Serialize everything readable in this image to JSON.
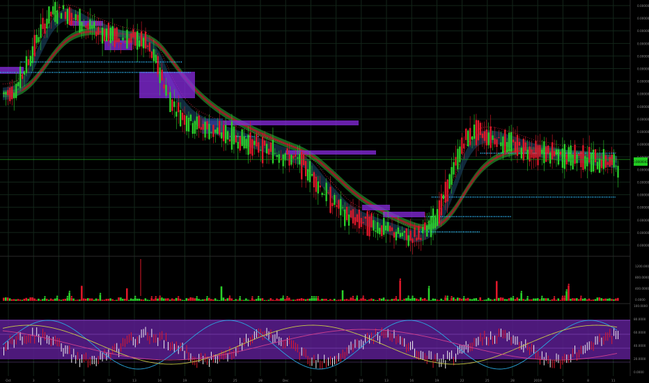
{
  "colors": {
    "background": "#000000",
    "grid": "#1a2a1a",
    "up": "#2bd12b",
    "down": "#e0182a",
    "purple": "#8a2be2",
    "band_fill": "#5a1d8f",
    "ribbon_green": "#1f8a2a",
    "ribbon_red": "#b0142a",
    "cyan_dots": "#2aa7e0",
    "price_tag": "#22cc22",
    "axis_text": "#8c8c8c"
  },
  "chart_data": [
    {
      "type": "line",
      "panel": "price",
      "series": [
        {
          "values": [
            5.9e-06,
            6e-06,
            6.6e-06,
            7.3e-06,
            7.8e-06,
            7.9e-06,
            7.7e-06,
            7.5e-06,
            7.4e-06,
            7.3e-06,
            7.2e-06,
            7.2e-06,
            7.1e-06,
            6.6e-06,
            5.8e-06,
            5.4e-06,
            5.2e-06,
            5.1e-06,
            5e-06,
            4.9e-06,
            4.8e-06,
            4.7e-06,
            4.6e-06,
            4.5e-06,
            4.4e-06,
            4.3e-06,
            4e-06,
            3.6e-06,
            3.3e-06,
            3e-06,
            2.9e-06,
            2.8e-06,
            2.7e-06,
            2.6e-06,
            2.5e-06,
            2.5e-06,
            2.7e-06,
            3.2e-06,
            4e-06,
            4.8e-06,
            5e-06,
            4.9e-06,
            4.8e-06,
            4.7e-06,
            4.6e-06,
            4.5e-06,
            4.5e-06,
            4.4e-06,
            4.4e-06,
            4.4e-06,
            4.3e-06,
            4.3e-06,
            4.2e-06
          ]
        }
      ],
      "price_tag": "0.0000043",
      "yticks": [
        "0.0000080",
        "0.0000077",
        "0.0000074",
        "0.0000071",
        "0.0000068",
        "0.0000065",
        "0.0000062",
        "0.0000059",
        "0.0000056",
        "0.0000053",
        "0.0000050",
        "0.0000047",
        "0.0000044",
        "0.0000041",
        "0.0000038",
        "0.0000035",
        "0.0000032",
        "0.0000029",
        "0.0000026",
        "0.0000023"
      ]
    },
    {
      "type": "bar",
      "panel": "volume",
      "yticks": [
        "1200.0000",
        "800.0000",
        "400.0000",
        "0.0000"
      ]
    },
    {
      "type": "line",
      "panel": "oscillator",
      "yticks": [
        "100.0000",
        "80.0000",
        "60.0000",
        "40.0000",
        "20.0000",
        "0.0000"
      ]
    }
  ],
  "xaxis": {
    "labels": [
      "Oct",
      "3",
      "5",
      "8",
      "10",
      "13",
      "16",
      "19",
      "22",
      "25",
      "28",
      "Dec",
      "3",
      "6",
      "10",
      "13",
      "16",
      "19",
      "22",
      "25",
      "28",
      "2019",
      "5",
      "8",
      "11"
    ]
  }
}
